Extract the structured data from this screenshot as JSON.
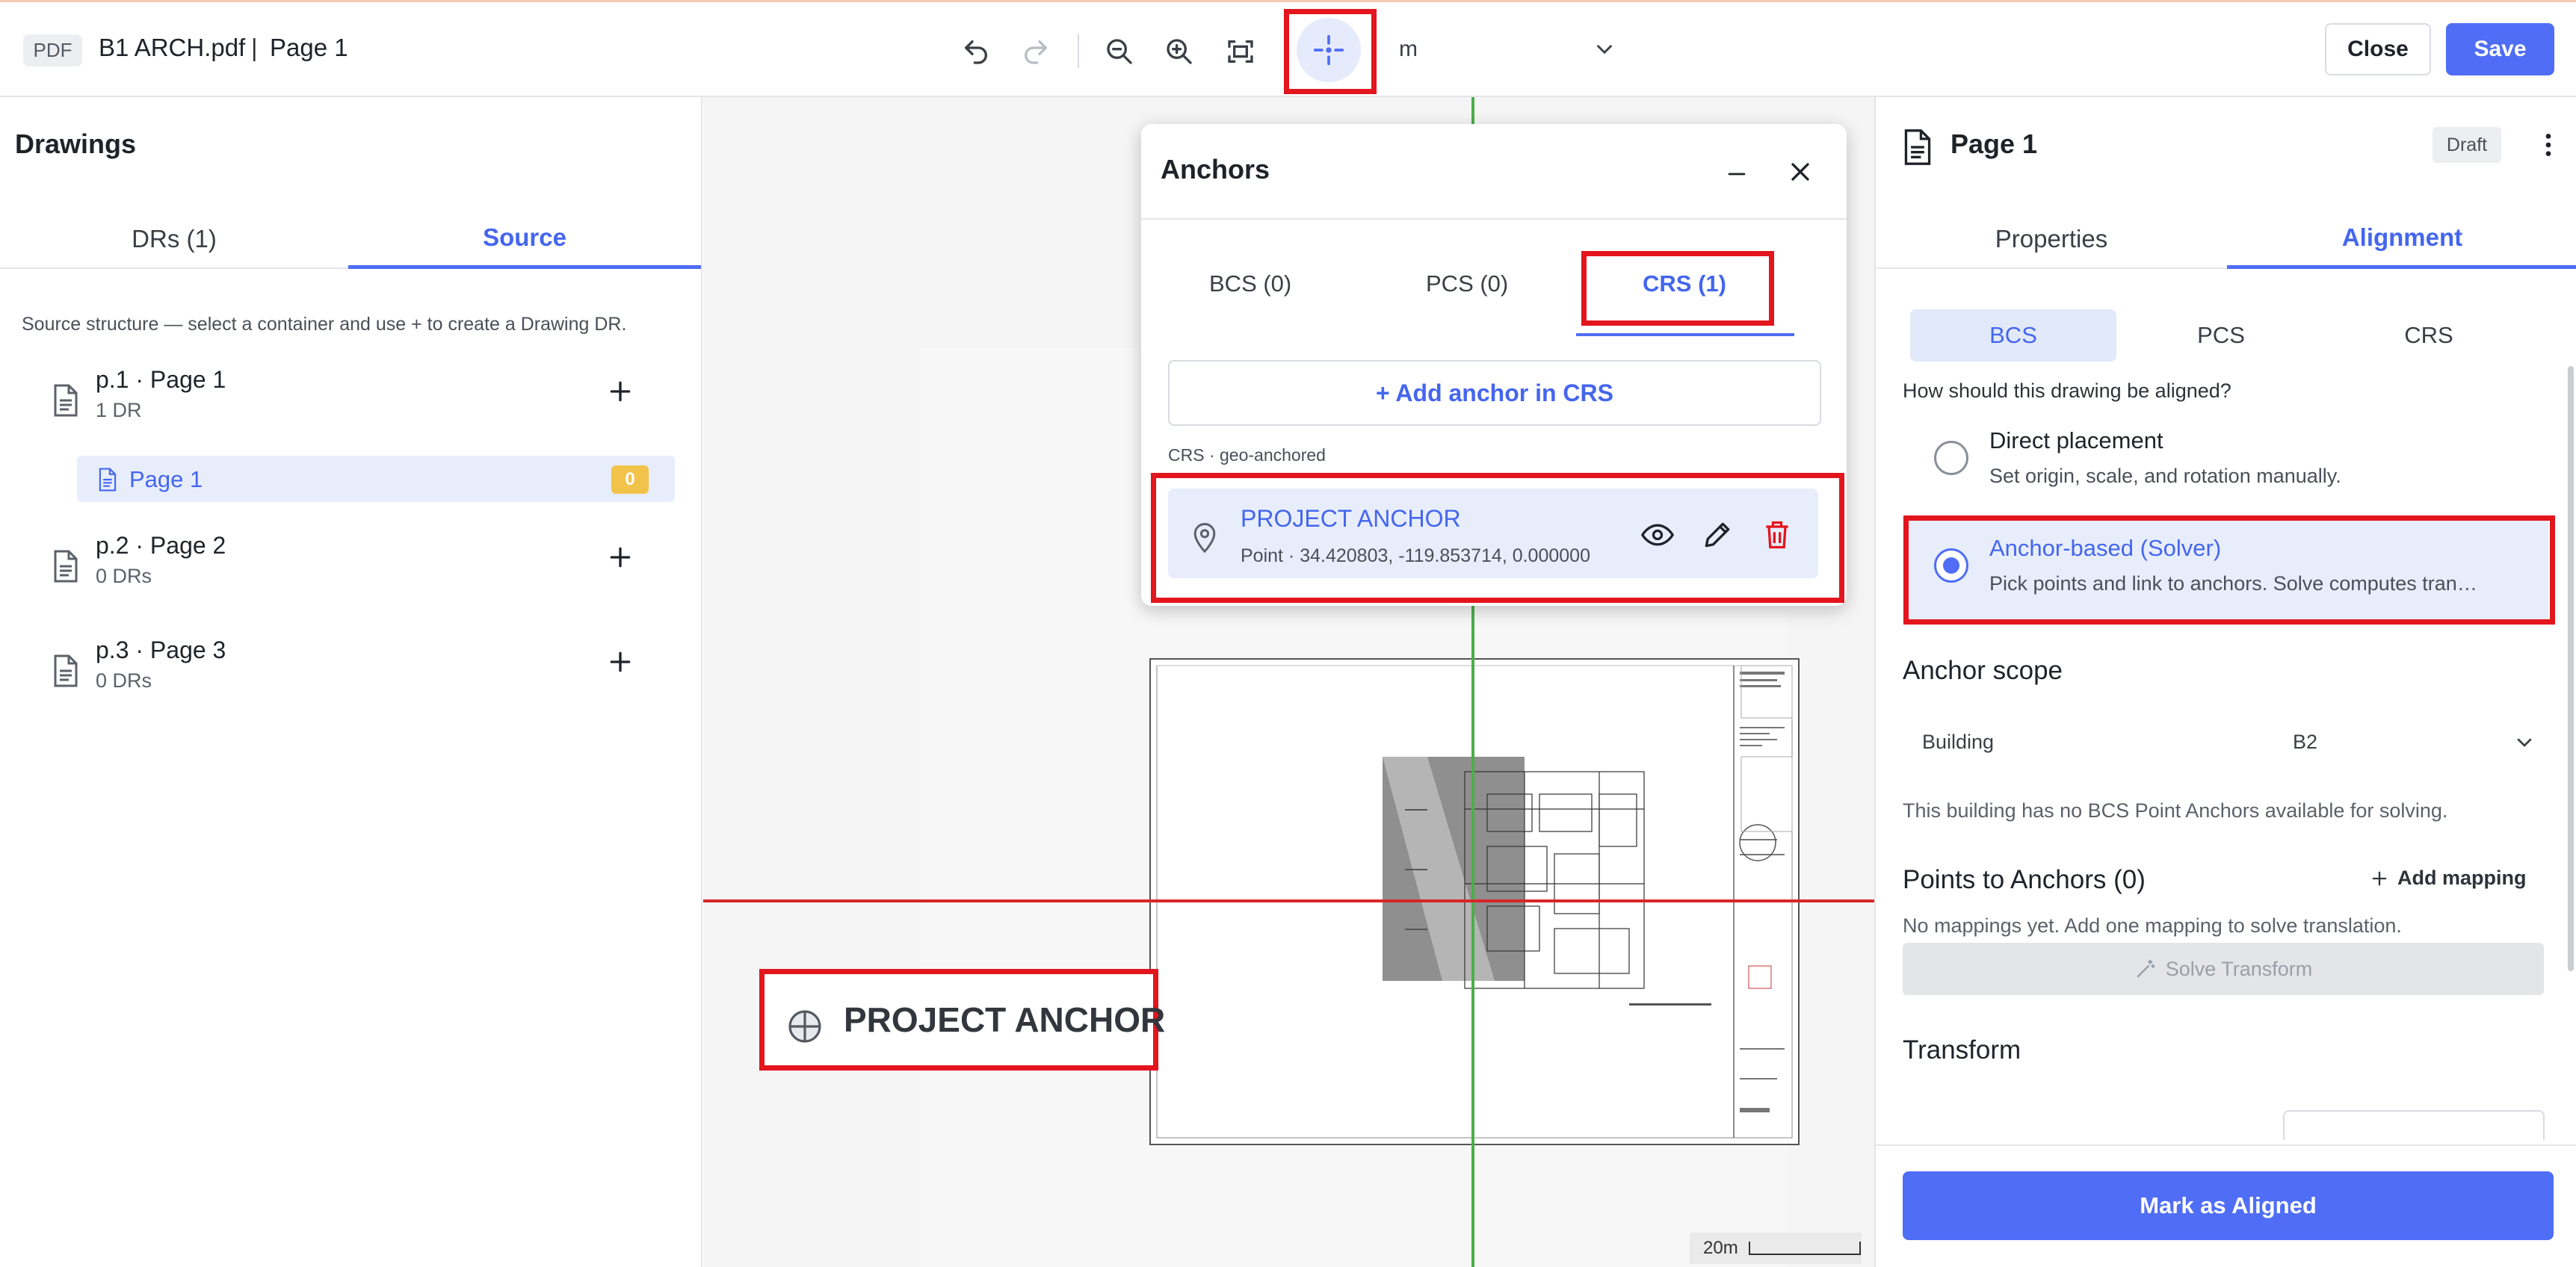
{
  "topbar": {
    "file_type_badge": "PDF",
    "document_name": "B1 ARCH.pdf",
    "separator": "|",
    "page_name": "Page 1",
    "units_value": "m",
    "close_label": "Close",
    "save_label": "Save",
    "icons": [
      "undo-icon",
      "redo-icon",
      "zoom-out-icon",
      "zoom-in-icon",
      "fit-screen-icon",
      "crosshair-icon",
      "chevron-down-icon"
    ]
  },
  "left_panel": {
    "title": "Drawings",
    "tabs": [
      {
        "label": "DRs (1)",
        "active": false
      },
      {
        "label": "Source",
        "active": true
      }
    ],
    "hint": "Source structure — select a container and use + to create a Drawing DR.",
    "tree": [
      {
        "title": "p.1 · Page 1",
        "subtitle": "1 DR"
      },
      {
        "title": "p.2 · Page 2",
        "subtitle": "0 DRs"
      },
      {
        "title": "p.3 · Page 3",
        "subtitle": "0 DRs"
      }
    ],
    "selected_page": {
      "label": "Page 1",
      "badge": "0"
    }
  },
  "canvas": {
    "anchor_label": "PROJECT ANCHOR",
    "scale_label": "20m",
    "crosshair_colors": {
      "vertical": "#4cae4c",
      "horizontal": "#d8262a"
    }
  },
  "anchors_panel": {
    "title": "Anchors",
    "tabs": [
      {
        "label": "BCS (0)",
        "active": false
      },
      {
        "label": "PCS (0)",
        "active": false
      },
      {
        "label": "CRS (1)",
        "active": true
      }
    ],
    "add_button": "+ Add anchor in CRS",
    "section_label": "CRS · geo-anchored",
    "items": [
      {
        "name": "PROJECT ANCHOR",
        "detail": "Point · 34.420803, -119.853714, 0.000000"
      }
    ]
  },
  "right_panel": {
    "title": "Page 1",
    "status": "Draft",
    "tabs": [
      {
        "label": "Properties",
        "active": false
      },
      {
        "label": "Alignment",
        "active": true
      }
    ],
    "segments": [
      {
        "label": "BCS",
        "active": true
      },
      {
        "label": "PCS",
        "active": false
      },
      {
        "label": "CRS",
        "active": false
      }
    ],
    "question": "How should this drawing be aligned?",
    "options": [
      {
        "title": "Direct placement",
        "desc": "Set origin, scale, and rotation manually.",
        "selected": false
      },
      {
        "title": "Anchor-based (Solver)",
        "desc": "Pick points and link to anchors. Solve computes tran…",
        "selected": true
      }
    ],
    "anchor_scope": {
      "heading": "Anchor scope",
      "key": "Building",
      "value": "B2",
      "note": "This building has no BCS Point Anchors available for solving."
    },
    "points": {
      "heading": "Points to Anchors (0)",
      "add_label": "Add mapping",
      "empty_note": "No mappings yet. Add one mapping to solve translation.",
      "solve_label": "Solve Transform"
    },
    "transform_heading": "Transform",
    "mark_button": "Mark as Aligned"
  },
  "colors": {
    "accent": "#4f6df5",
    "highlight_box": "#e3151d",
    "selected_bg": "#e8edfc",
    "badge_yellow": "#f1c34a"
  }
}
